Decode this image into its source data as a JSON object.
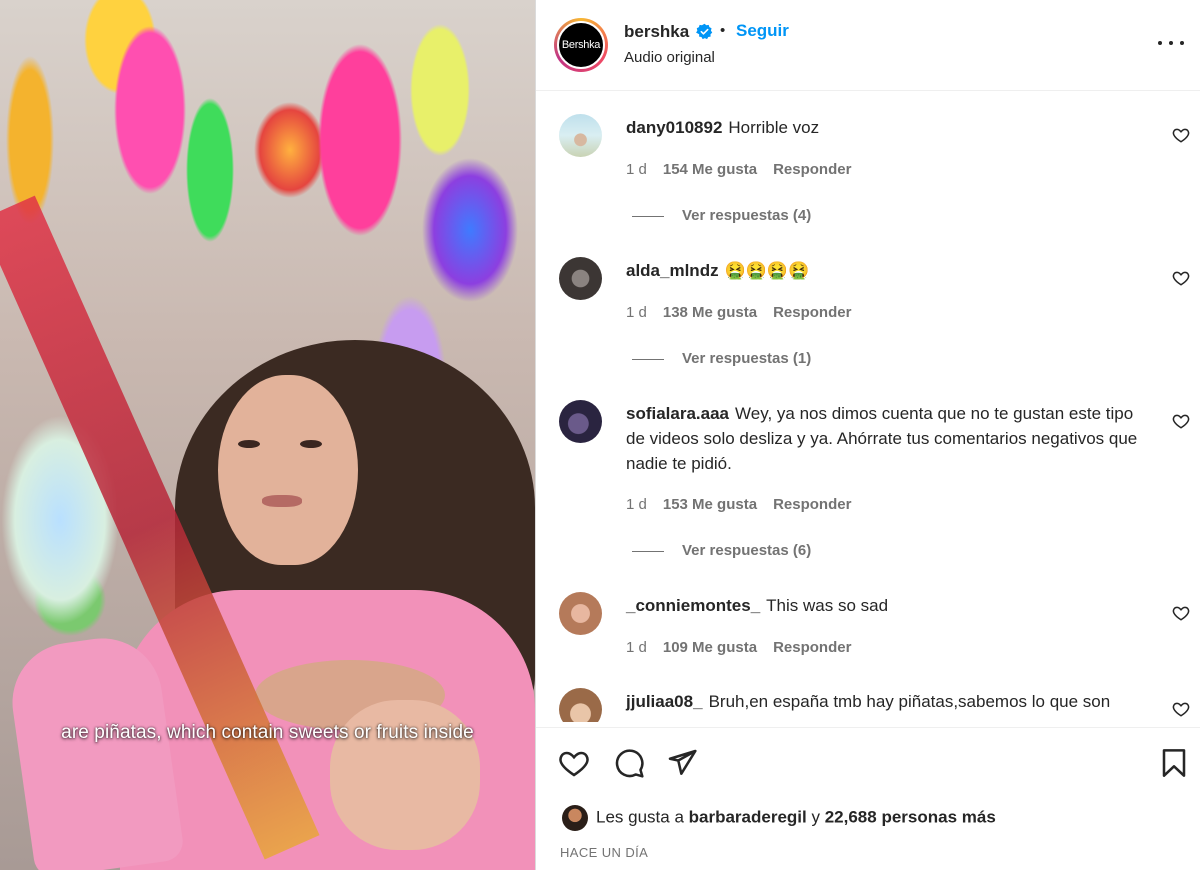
{
  "video": {
    "caption": "are piñatas, which contain sweets or fruits inside"
  },
  "header": {
    "username": "bershka",
    "avatar_text": "Bershka",
    "separator": "•",
    "follow_label": "Seguir",
    "audio_label": "Audio original",
    "verified": true
  },
  "comments": [
    {
      "username": "dany010892",
      "text": "Horrible voz",
      "time": "1 d",
      "likes": "154 Me gusta",
      "reply_label": "Responder",
      "view_replies": "Ver respuestas (4)"
    },
    {
      "username": "alda_mlndz",
      "text": "🤮🤮🤮🤮",
      "time": "1 d",
      "likes": "138 Me gusta",
      "reply_label": "Responder",
      "view_replies": "Ver respuestas (1)"
    },
    {
      "username": "sofialara.aaa",
      "text": "Wey, ya nos dimos cuenta que no te gustan este tipo de videos solo desliza y ya. Ahórrate tus comentarios negativos que nadie te pidió.",
      "time": "1 d",
      "likes": "153 Me gusta",
      "reply_label": "Responder",
      "view_replies": "Ver respuestas (6)"
    },
    {
      "username": "_conniemontes_",
      "text": "This was so sad",
      "time": "1 d",
      "likes": "109 Me gusta",
      "reply_label": "Responder"
    },
    {
      "username": "jjuliaa08_",
      "text": "Bruh,en españa tmb hay piñatas,sabemos lo que son"
    }
  ],
  "footer": {
    "likes_prefix": "Les gusta a",
    "likes_user": "barbaraderegil",
    "likes_conj": "y",
    "likes_count": "22,688 personas más",
    "timestamp": "HACE UN DÍA"
  },
  "colors": {
    "accent": "#0095f6",
    "text": "#262626",
    "muted": "#737373",
    "border": "#dbdbdb"
  },
  "icons": [
    "verified-badge-icon",
    "more-options-icon",
    "heart-icon",
    "comment-icon",
    "share-icon",
    "bookmark-icon"
  ]
}
